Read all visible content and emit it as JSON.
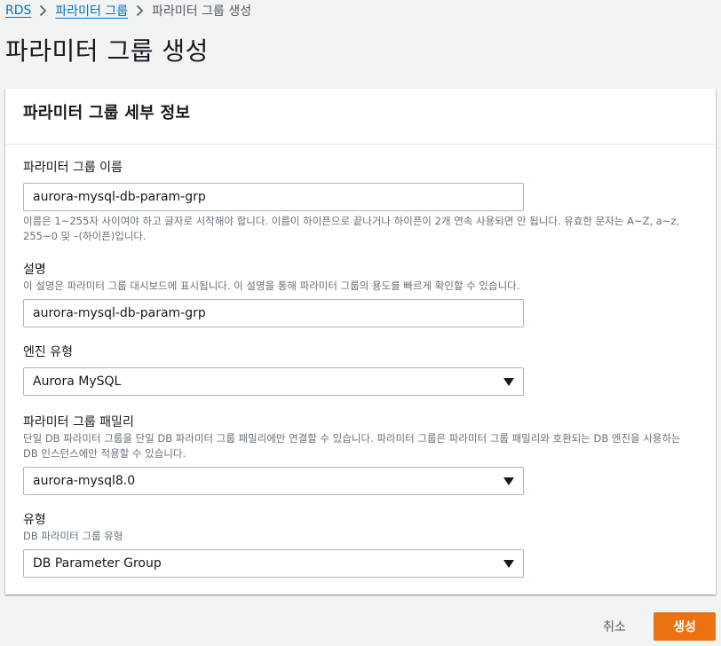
{
  "breadcrumb": {
    "items": [
      "RDS",
      "파라미터 그룹"
    ],
    "current": "파라미터 그룹 생성"
  },
  "page": {
    "title": "파라미터 그룹 생성"
  },
  "panel": {
    "title": "파라미터 그룹 세부 정보"
  },
  "fields": {
    "name": {
      "label": "파라미터 그룹 이름",
      "value": "aurora-mysql-db-param-grp",
      "hint": "이름은 1~255자 사이여야 하고 글자로 시작해야 합니다. 이름이 하이픈으로 끝나거나 하이픈이 2개 연속 사용되면 안 됩니다. 유효한 문자는 A~Z, a~z, 255~0 및 –(하이픈)입니다."
    },
    "description": {
      "label": "설명",
      "hint": "이 설명은 파라미터 그룹 대시보드에 표시됩니다. 이 설명을 통해 파라미터 그룹의 용도를 빠르게 확인할 수 있습니다.",
      "value": "aurora-mysql-db-param-grp"
    },
    "engine": {
      "label": "엔진 유형",
      "value": "Aurora MySQL"
    },
    "family": {
      "label": "파라미터 그룹 패밀리",
      "hint": "단일 DB 파라미터 그룹을 단일 DB 파라미터 그룹 패밀리에만 연결할 수 있습니다. 파라미터 그룹은 파라미터 그룹 패밀리와 호환되는 DB 엔진을 사용하는 DB 인스턴스에만 적용할 수 있습니다.",
      "value": "aurora-mysql8.0"
    },
    "type": {
      "label": "유형",
      "hint": "DB 파라미터 그룹 유형",
      "value": "DB Parameter Group"
    }
  },
  "actions": {
    "cancel_label": "취소",
    "create_label": "생성"
  },
  "colors": {
    "link": "#0073bb",
    "primary_button": "#ec7211",
    "background": "#f2f3f3"
  }
}
